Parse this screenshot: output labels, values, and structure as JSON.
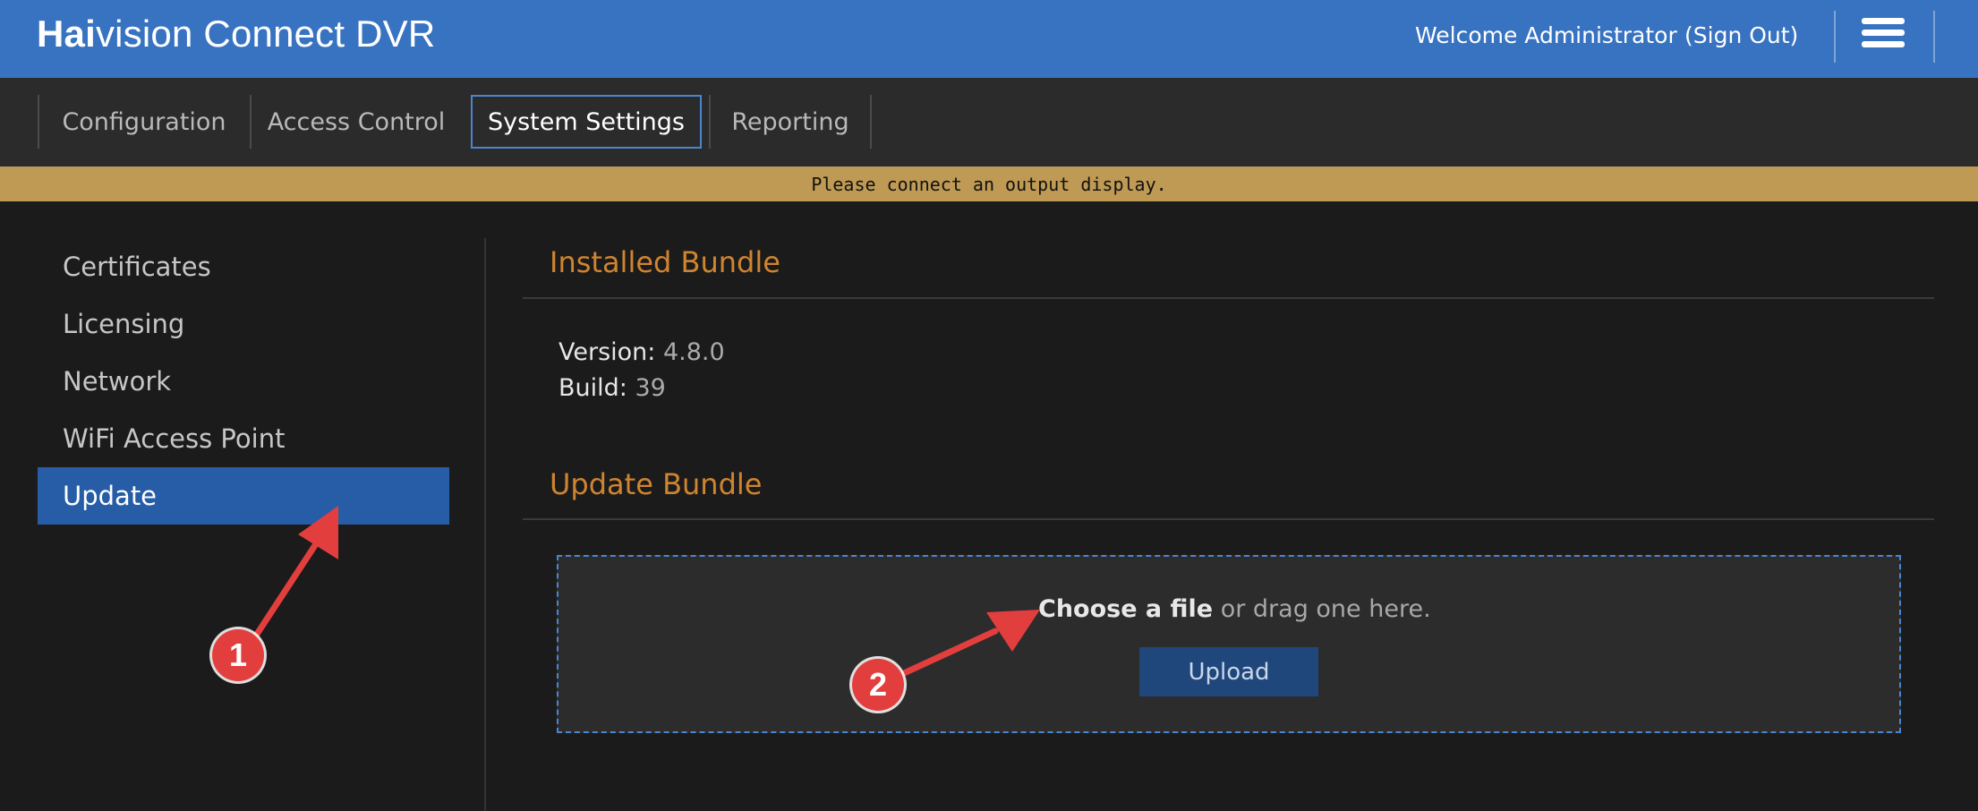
{
  "header": {
    "brand_bold": "Hai",
    "brand_rest": "vision Connect DVR",
    "welcome": "Welcome Administrator",
    "sign_out": "(Sign Out)",
    "menu_icon": "hamburger-menu-icon"
  },
  "nav": {
    "tabs": [
      {
        "label": "Configuration"
      },
      {
        "label": "Access Control"
      },
      {
        "label": "System Settings",
        "active": true
      },
      {
        "label": "Reporting"
      }
    ]
  },
  "alert": {
    "message": "Please connect an output display."
  },
  "sidebar": {
    "items": [
      {
        "label": "Certificates"
      },
      {
        "label": "Licensing"
      },
      {
        "label": "Network"
      },
      {
        "label": "WiFi Access Point"
      },
      {
        "label": "Update",
        "active": true
      }
    ]
  },
  "installed": {
    "title": "Installed Bundle",
    "version_label": "Version:",
    "version_value": "4.8.0",
    "build_label": "Build:",
    "build_value": "39"
  },
  "update": {
    "title": "Update Bundle",
    "choose": "Choose a file",
    "drag_text": " or drag one here.",
    "upload_label": "Upload"
  },
  "annotations": {
    "badge_1": "1",
    "badge_2": "2"
  },
  "colors": {
    "header_blue": "#3873c1",
    "nav_bg": "#2b2b2b",
    "alert_bg": "#bf9a54",
    "accent_orange": "#d0842f",
    "sidebar_active": "#265da6",
    "annotation_red": "#e33e3e"
  }
}
